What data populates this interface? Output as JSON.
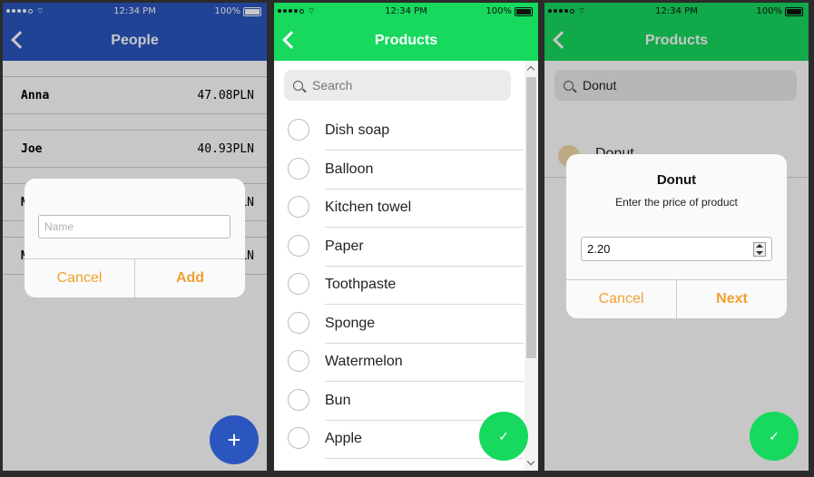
{
  "status_bar": {
    "time": "12:34 PM",
    "battery": "100%"
  },
  "screen1": {
    "title": "People",
    "people": [
      {
        "name": "Anna",
        "amount": "47.08PLN"
      },
      {
        "name": "Joe",
        "amount": "40.93PLN"
      },
      {
        "name": "M",
        "amount": "PLN"
      },
      {
        "name": "M",
        "amount": "PLN"
      }
    ],
    "dialog": {
      "placeholder": "Name",
      "cancel": "Cancel",
      "add": "Add"
    },
    "fab_icon": "+",
    "colors": {
      "accent": "#2b56c0"
    }
  },
  "screen2": {
    "title": "Products",
    "search_placeholder": "Search",
    "products": [
      "Dish soap",
      "Balloon",
      "Kitchen towel",
      "Paper",
      "Toothpaste",
      "Sponge",
      "Watermelon",
      "Bun",
      "Apple"
    ],
    "fab_icon": "✓",
    "colors": {
      "accent": "#16d95e"
    }
  },
  "screen3": {
    "title": "Products",
    "search_value": "Donut",
    "list_item": "Donut",
    "dialog": {
      "title": "Donut",
      "subtitle": "Enter the price of product",
      "value": "2.20",
      "cancel": "Cancel",
      "next": "Next"
    },
    "fab_icon": "✓"
  }
}
